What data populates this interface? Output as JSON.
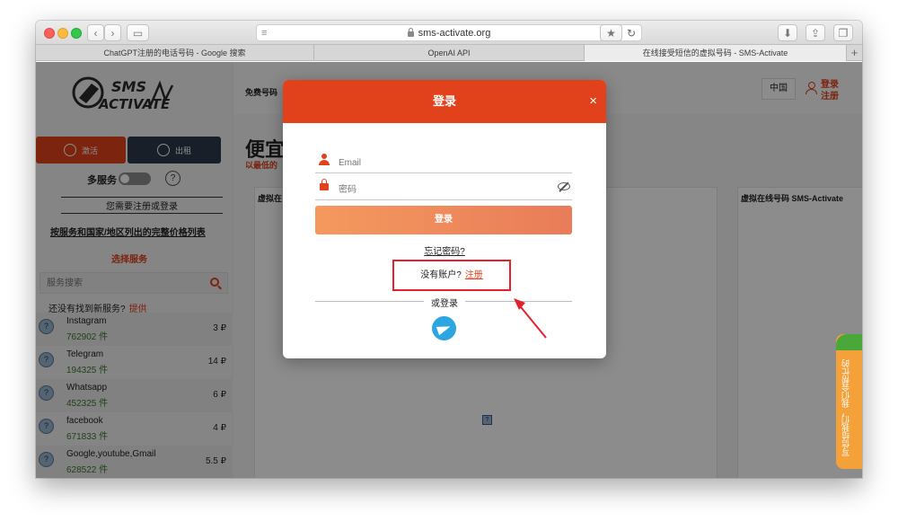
{
  "browser": {
    "url": "sms-activate.org",
    "tabs": [
      {
        "title": "ChatGPT注册的电话号码 - Google 搜索"
      },
      {
        "title": "OpenAI API"
      },
      {
        "title": "在线接受短信的虚拟号码 - SMS-Activate"
      }
    ],
    "new_tab": "+"
  },
  "sidebar": {
    "logo_line1": "SMS",
    "logo_line2": "ACTIVATE",
    "activate_label": "激活",
    "rent_label": "出租",
    "multi_service": "多服务",
    "help": "?",
    "need_register": "您需要注册或登录",
    "price_list": "按服务和国家/地区列出的完整价格列表",
    "choose_service": "选择服务",
    "search_placeholder": "服务搜索",
    "not_found": "还没有找到新服务?",
    "provide": "提供",
    "services": [
      {
        "name": "Instagram",
        "count": "762902 件",
        "price": "3 ₽"
      },
      {
        "name": "Telegram",
        "count": "194325 件",
        "price": "14 ₽"
      },
      {
        "name": "Whatsapp",
        "count": "452325 件",
        "price": "6 ₽"
      },
      {
        "name": "facebook",
        "count": "671833 件",
        "price": "4 ₽"
      },
      {
        "name": "Google,youtube,Gmail",
        "count": "628522 件",
        "price": "5.5 ₽"
      }
    ]
  },
  "main": {
    "free_numbers": "免费号码",
    "language": "中国",
    "login": "登录",
    "register": "注册",
    "heading": "便宜",
    "subheading": "以最低的",
    "panel_left_title": "虚拟在",
    "panel_right_title": "虚拟在线号码 SMS-Activate",
    "help_tab": "写信给我们，我们会帮忙的"
  },
  "modal": {
    "title": "登录",
    "close": "×",
    "email_placeholder": "Email",
    "password_placeholder": "密码",
    "login_button": "登录",
    "forgot": "忘记密码?",
    "no_account": "没有账户?",
    "register": "注册",
    "or_login": "或登录"
  },
  "colors": {
    "accent": "#e2421b",
    "annotation": "#e4212d",
    "telegram": "#2ca5e0"
  }
}
